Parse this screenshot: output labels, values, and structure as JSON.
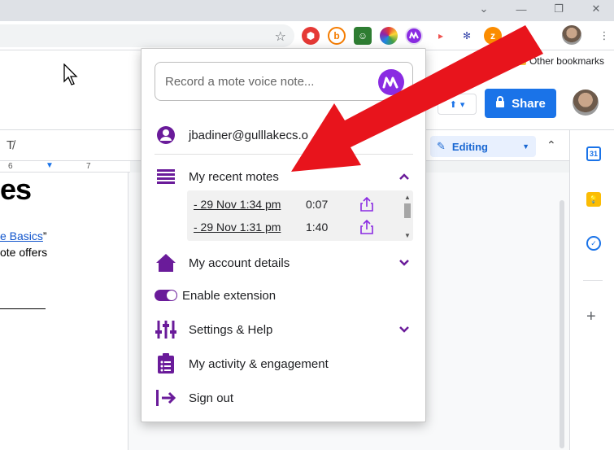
{
  "browser": {
    "window_controls": [
      "⌄",
      "—",
      "❐",
      "✕"
    ],
    "bookmarks_other": "Other bookmarks"
  },
  "docs": {
    "share_label": "Share",
    "editing_label": "Editing",
    "ruler_marks": [
      "6",
      "7"
    ],
    "heading_fragment": "es",
    "body_link": "e Basics",
    "body_after_link": "”",
    "body_line2": "ote offers"
  },
  "popup": {
    "record_placeholder": "Record a mote voice note...",
    "account_email": "jbadiner@gulllakecs.o",
    "recent_motes_label": "My recent motes",
    "motes": [
      {
        "date": "- 29 Nov 1:34 pm",
        "duration": "0:07"
      },
      {
        "date": "- 29 Nov 1:31 pm",
        "duration": "1:40"
      }
    ],
    "account_details_label": "My account details",
    "enable_extension_label": "Enable extension",
    "settings_help_label": "Settings & Help",
    "activity_label": "My activity & engagement",
    "sign_out_label": "Sign out"
  },
  "colors": {
    "mote_purple": "#6a1b9a",
    "mote_brand": "#8a2be2",
    "share_blue": "#1a73e8",
    "arrow_red": "#e8141c"
  }
}
